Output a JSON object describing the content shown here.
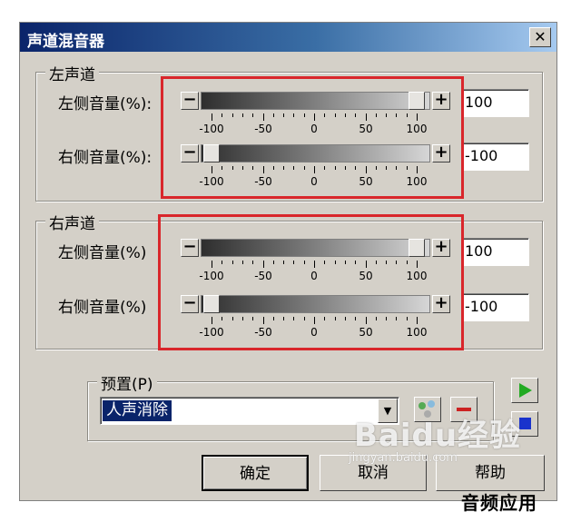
{
  "window": {
    "title": "声道混音器",
    "close_glyph": "✕"
  },
  "left_channel": {
    "group_label": "左声道",
    "left_volume": {
      "label": "左侧音量(%):",
      "value": "100",
      "level": 100
    },
    "right_volume": {
      "label": "右侧音量(%):",
      "value": "-100",
      "level": -100
    }
  },
  "right_channel": {
    "group_label": "右声道",
    "left_volume": {
      "label": "左侧音量(%)",
      "value": "100",
      "level": 100
    },
    "right_volume": {
      "label": "右侧音量(%)",
      "value": "-100",
      "level": -100
    }
  },
  "scale": {
    "labels": [
      "-100",
      "-50",
      "0",
      "50",
      "100"
    ],
    "min": -100,
    "max": 100
  },
  "slider_buttons": {
    "minus": "−",
    "plus": "+"
  },
  "preset": {
    "group_label": "预置(P)",
    "selected": "人声消除",
    "dropdown_glyph": "▼"
  },
  "icons": {
    "add": "multi-circle-icon",
    "remove": "minus-icon",
    "play": "play-icon",
    "stop": "stop-icon"
  },
  "colors": {
    "play": "#22aa22",
    "stop": "#1a33cc",
    "remove": "#cc2222",
    "highlight": "#d9262b"
  },
  "buttons": {
    "ok": "确定",
    "cancel": "取消",
    "help": "帮助"
  },
  "watermark": {
    "brand": "Baidu经验",
    "url": "jingyan.baidu.com"
  },
  "caption": "音频应用"
}
